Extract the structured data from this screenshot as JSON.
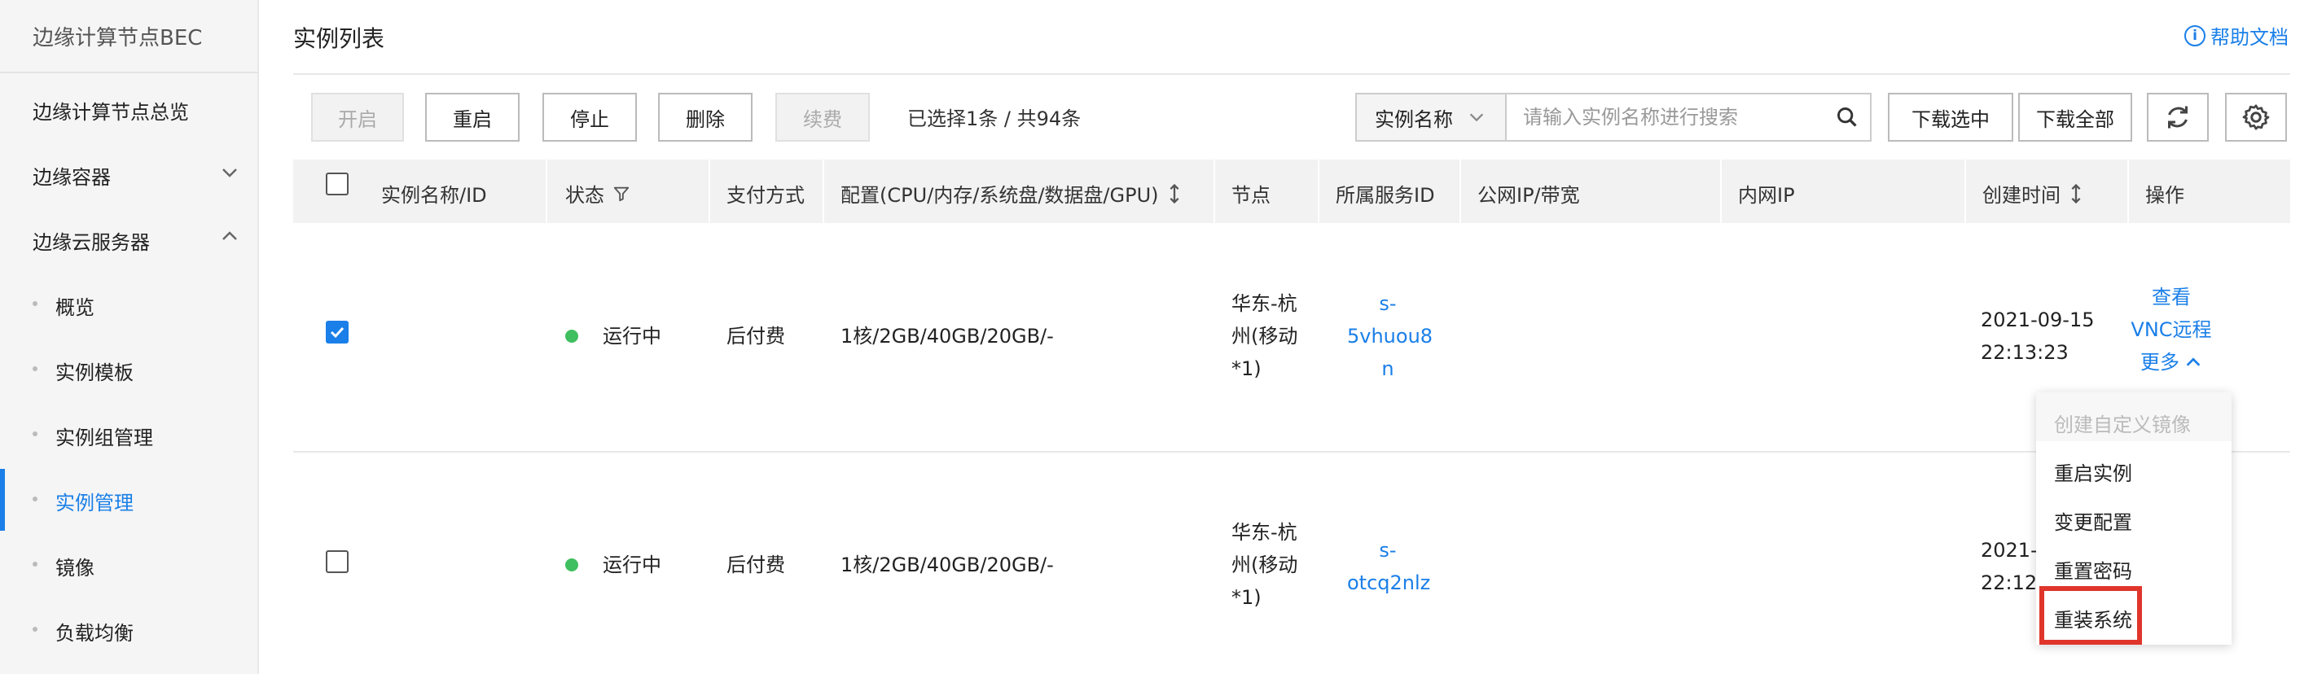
{
  "sidebar": {
    "title": "边缘计算节点BEC",
    "items": [
      {
        "label": "边缘计算节点总览"
      },
      {
        "label": "边缘容器"
      },
      {
        "label": "边缘云服务器"
      }
    ],
    "sub_items": [
      {
        "label": "概览"
      },
      {
        "label": "实例模板"
      },
      {
        "label": "实例组管理"
      },
      {
        "label": "实例管理"
      },
      {
        "label": "镜像"
      },
      {
        "label": "负载均衡"
      }
    ]
  },
  "header": {
    "title": "实例列表",
    "help": "帮助文档"
  },
  "toolbar": {
    "start": "开启",
    "restart": "重启",
    "stop": "停止",
    "delete": "删除",
    "renew": "续费",
    "selection": "已选择1条 / 共94条",
    "search_scope": "实例名称",
    "search_placeholder": "请输入实例名称进行搜索",
    "download_selected": "下载选中",
    "download_all": "下载全部"
  },
  "table": {
    "columns": [
      "实例名称/ID",
      "状态",
      "支付方式",
      "配置(CPU/内存/系统盘/数据盘/GPU)",
      "节点",
      "所属服务ID",
      "公网IP/带宽",
      "内网IP",
      "创建时间",
      "操作"
    ],
    "rows": [
      {
        "checked": true,
        "status": "运行中",
        "payment": "后付费",
        "config": "1核/2GB/40GB/20GB/-",
        "node": [
          "华东-杭",
          "州(移动",
          "*1)"
        ],
        "service_id": [
          "s-",
          "5vhuou8",
          "n"
        ],
        "created": [
          "2021-09-15",
          "22:13:23"
        ],
        "actions": [
          "查看",
          "VNC远程",
          "更多"
        ]
      },
      {
        "checked": false,
        "status": "运行中",
        "payment": "后付费",
        "config": "1核/2GB/40GB/20GB/-",
        "node": [
          "华东-杭",
          "州(移动",
          "*1)"
        ],
        "service_id": [
          "s-",
          "otcq2nlz"
        ],
        "created": [
          "2021-0",
          "22:12:"
        ]
      }
    ]
  },
  "more_menu": {
    "items": [
      "创建自定义镜像",
      "重启实例",
      "变更配置",
      "重置密码",
      "重装系统"
    ]
  }
}
